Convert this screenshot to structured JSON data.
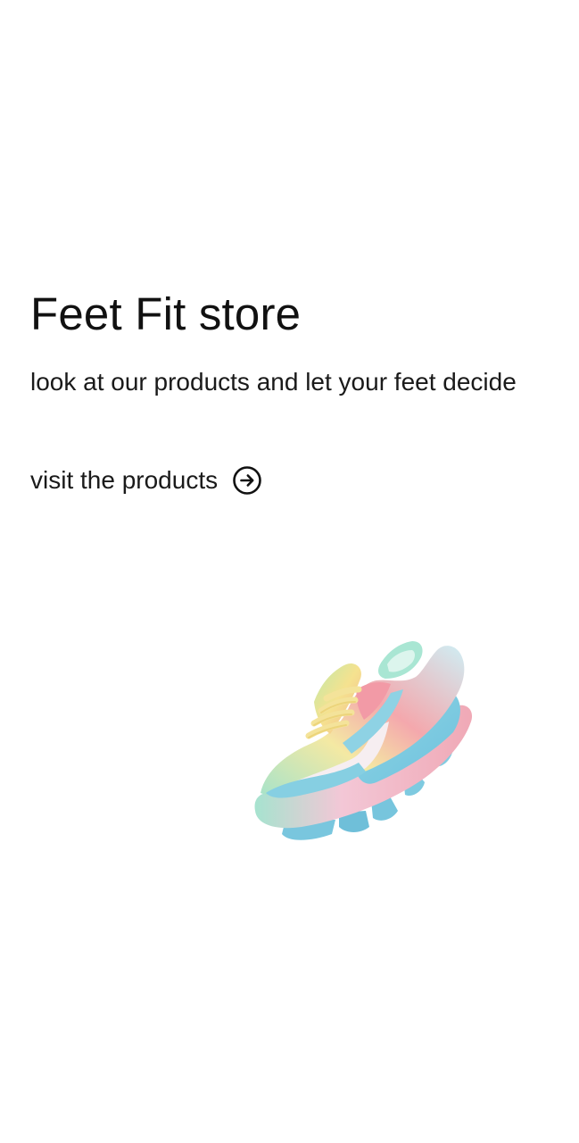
{
  "hero": {
    "title": "Feet Fit store",
    "subtitle": "look at our products and let your feet decide"
  },
  "cta": {
    "label": "visit the products",
    "icon": "arrow-right-circle-icon"
  },
  "illustration": {
    "icon": "sneaker-illustration",
    "colors": {
      "sole": "#7ec9df",
      "upper": "#f6e9ef",
      "accent_pink": "#ef9aa6",
      "accent_yellow": "#f4e59a",
      "accent_green": "#9fe0c6"
    }
  }
}
